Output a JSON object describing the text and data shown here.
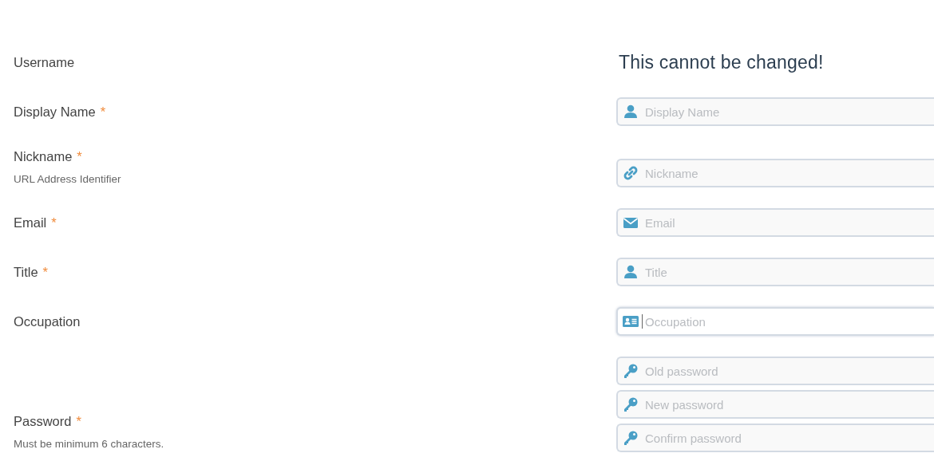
{
  "rows": [
    {
      "label": "Username",
      "note": "This cannot be changed!"
    },
    {
      "label": "Display Name",
      "mark": "*",
      "inputs": [
        {
          "kind": "person",
          "placeholder": "Display Name",
          "focused": false
        }
      ]
    },
    {
      "label": "Nickname",
      "mark": "*",
      "hint": "URL Address Identifier",
      "inputs": [
        {
          "kind": "link",
          "placeholder": "Nickname",
          "focused": false
        }
      ]
    },
    {
      "label": "Email",
      "mark": "*",
      "inputs": [
        {
          "kind": "envelope",
          "placeholder": "Email",
          "focused": false
        }
      ]
    },
    {
      "label": "Title",
      "mark": "*",
      "inputs": [
        {
          "kind": "person",
          "placeholder": "Title",
          "focused": false
        }
      ]
    },
    {
      "label": "Occupation",
      "inputs": [
        {
          "kind": "idcard",
          "placeholder": "Occupation",
          "focused": true
        }
      ]
    },
    {
      "label": "Password",
      "mark": "*",
      "hint": "Must be minimum 6 characters.",
      "inputs": [
        {
          "kind": "key",
          "placeholder": "Old password",
          "focused": false
        },
        {
          "kind": "key",
          "placeholder": "New password",
          "focused": false
        },
        {
          "kind": "key",
          "placeholder": "Confirm password",
          "focused": false
        }
      ]
    }
  ]
}
